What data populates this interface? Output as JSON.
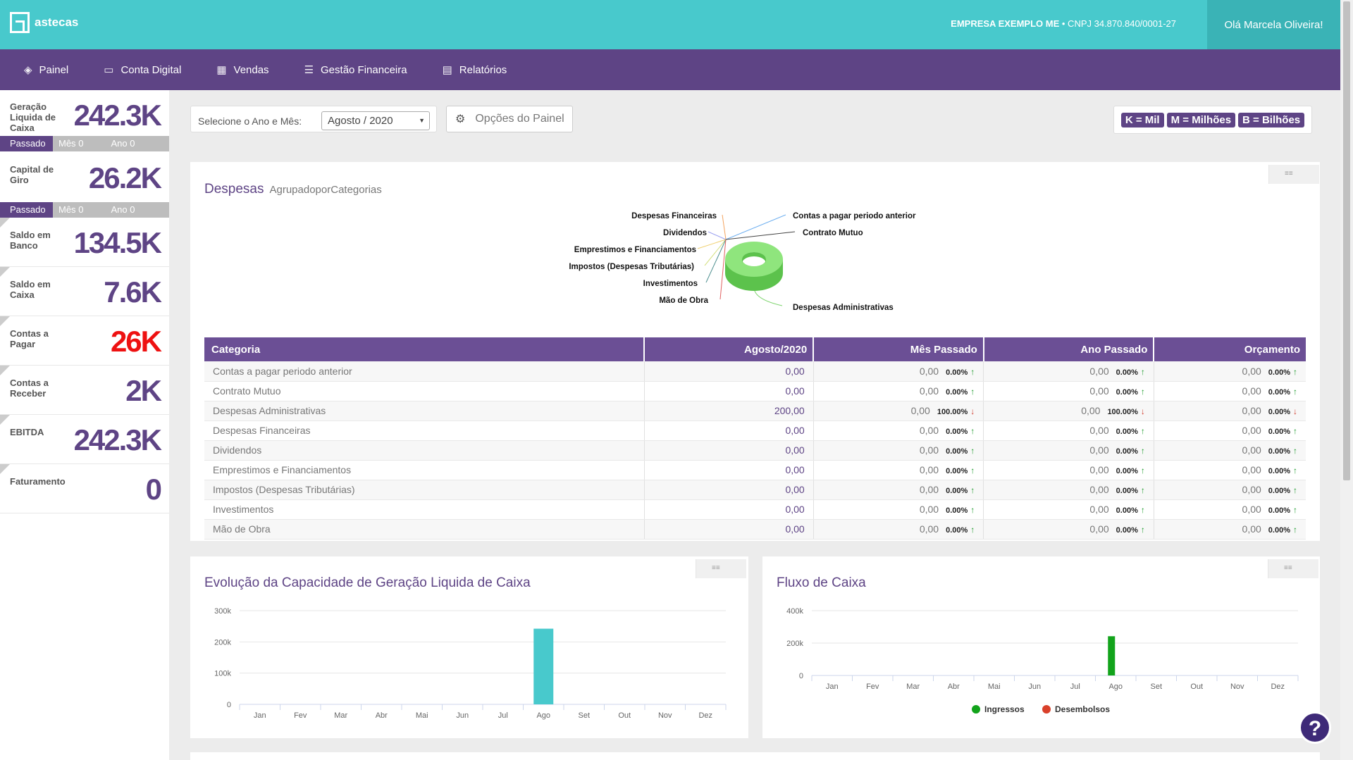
{
  "brand": {
    "name": "astecas",
    "accent": "#48c9cc",
    "purple": "#5e4485"
  },
  "header": {
    "company_name": "EMPRESA EXEMPLO ME",
    "company_cnpj": "• CNPJ 34.870.840/0001-27",
    "greeting": "Olá Marcela Oliveira!"
  },
  "nav": [
    {
      "label": "Painel",
      "icon": "cube-icon"
    },
    {
      "label": "Conta Digital",
      "icon": "credit-card-icon"
    },
    {
      "label": "Vendas",
      "icon": "calculator-icon"
    },
    {
      "label": "Gestão Financeira",
      "icon": "list-icon"
    },
    {
      "label": "Relatórios",
      "icon": "report-icon"
    }
  ],
  "sidebar": {
    "kpis": [
      {
        "label": "Geração Liquida de Caixa",
        "value": "242.3K"
      },
      {
        "label": "Capital de Giro",
        "value": "26.2K"
      },
      {
        "label": "Saldo em Banco",
        "value": "134.5K"
      },
      {
        "label": "Saldo em Caixa",
        "value": "7.6K"
      },
      {
        "label": "Contas a Pagar",
        "value": "26K"
      },
      {
        "label": "Contas a Receber",
        "value": "2K"
      },
      {
        "label": "EBITDA",
        "value": "242.3K"
      },
      {
        "label": "Faturamento",
        "value": "0"
      }
    ],
    "compare": {
      "passado": "Passado",
      "mes": "Mês",
      "ano": "Ano",
      "mes_val": "0",
      "ano_val": "0"
    }
  },
  "filters": {
    "label": "Selecione o Ano e Mês:",
    "selected": "Agosto / 2020",
    "options_button": "Opções do Painel"
  },
  "units": [
    "K = Mil",
    "M = Milhões",
    "B = Bilhões"
  ],
  "despesas": {
    "title": "Despesas",
    "subtitle": "AgrupadoporCategorias",
    "pie_labels_left": [
      "Despesas Financeiras",
      "Dividendos",
      "Emprestimos e Financiamentos",
      "Impostos (Despesas Tributárias)",
      "Investimentos",
      "Mão de Obra"
    ],
    "pie_labels_right": [
      "Contas a pagar periodo anterior",
      "Contrato Mutuo",
      "Despesas Administrativas"
    ],
    "columns": [
      "Categoria",
      "Agosto/2020",
      "Mês Passado",
      "Ano Passado",
      "Orçamento"
    ],
    "rows": [
      {
        "cat": "Contas a pagar periodo anterior",
        "cur": "0,00",
        "mp": "0,00",
        "mpp": "0.00%",
        "mpd": "up",
        "ap": "0,00",
        "app": "0.00%",
        "apd": "up",
        "orc": "0,00",
        "orcp": "0.00%",
        "orcd": "up"
      },
      {
        "cat": "Contrato Mutuo",
        "cur": "0,00",
        "mp": "0,00",
        "mpp": "0.00%",
        "mpd": "up",
        "ap": "0,00",
        "app": "0.00%",
        "apd": "up",
        "orc": "0,00",
        "orcp": "0.00%",
        "orcd": "up"
      },
      {
        "cat": "Despesas Administrativas",
        "cur": "200,00",
        "mp": "0,00",
        "mpp": "100.00%",
        "mpd": "down",
        "ap": "0,00",
        "app": "100.00%",
        "apd": "down",
        "orc": "0,00",
        "orcp": "0.00%",
        "orcd": "down"
      },
      {
        "cat": "Despesas Financeiras",
        "cur": "0,00",
        "mp": "0,00",
        "mpp": "0.00%",
        "mpd": "up",
        "ap": "0,00",
        "app": "0.00%",
        "apd": "up",
        "orc": "0,00",
        "orcp": "0.00%",
        "orcd": "up"
      },
      {
        "cat": "Dividendos",
        "cur": "0,00",
        "mp": "0,00",
        "mpp": "0.00%",
        "mpd": "up",
        "ap": "0,00",
        "app": "0.00%",
        "apd": "up",
        "orc": "0,00",
        "orcp": "0.00%",
        "orcd": "up"
      },
      {
        "cat": "Emprestimos e Financiamentos",
        "cur": "0,00",
        "mp": "0,00",
        "mpp": "0.00%",
        "mpd": "up",
        "ap": "0,00",
        "app": "0.00%",
        "apd": "up",
        "orc": "0,00",
        "orcp": "0.00%",
        "orcd": "up"
      },
      {
        "cat": "Impostos (Despesas Tributárias)",
        "cur": "0,00",
        "mp": "0,00",
        "mpp": "0.00%",
        "mpd": "up",
        "ap": "0,00",
        "app": "0.00%",
        "apd": "up",
        "orc": "0,00",
        "orcp": "0.00%",
        "orcd": "up"
      },
      {
        "cat": "Investimentos",
        "cur": "0,00",
        "mp": "0,00",
        "mpp": "0.00%",
        "mpd": "up",
        "ap": "0,00",
        "app": "0.00%",
        "apd": "up",
        "orc": "0,00",
        "orcp": "0.00%",
        "orcd": "up"
      },
      {
        "cat": "Mão de Obra",
        "cur": "0,00",
        "mp": "0,00",
        "mpp": "0.00%",
        "mpd": "up",
        "ap": "0,00",
        "app": "0.00%",
        "apd": "up",
        "orc": "0,00",
        "orcp": "0.00%",
        "orcd": "up"
      }
    ]
  },
  "chart_data": [
    {
      "type": "bar",
      "title": "Evolução da Capacidade de Geração Liquida de Caixa",
      "categories": [
        "Jan",
        "Fev",
        "Mar",
        "Abr",
        "Mai",
        "Jun",
        "Jul",
        "Ago",
        "Set",
        "Out",
        "Nov",
        "Dez"
      ],
      "series": [
        {
          "values": [
            0,
            0,
            0,
            0,
            0,
            0,
            0,
            242300,
            0,
            0,
            0,
            0
          ],
          "color": "#48c9cc"
        }
      ],
      "ylim": [
        0,
        300000
      ],
      "yticks": [
        "0",
        "100k",
        "200k",
        "300k"
      ],
      "grid": true
    },
    {
      "type": "bar",
      "title": "Fluxo de Caixa",
      "categories": [
        "Jan",
        "Fev",
        "Mar",
        "Abr",
        "Mai",
        "Jun",
        "Jul",
        "Ago",
        "Set",
        "Out",
        "Nov",
        "Dez"
      ],
      "series": [
        {
          "name": "Ingressos",
          "values": [
            0,
            0,
            0,
            0,
            0,
            0,
            0,
            242300,
            0,
            0,
            0,
            0
          ],
          "color": "#12a31b"
        },
        {
          "name": "Desembolsos",
          "values": [
            0,
            0,
            0,
            0,
            0,
            0,
            0,
            0,
            0,
            0,
            0,
            0
          ],
          "color": "#d9402a"
        }
      ],
      "ylim": [
        0,
        400000
      ],
      "yticks": [
        "0",
        "200k",
        "400k"
      ],
      "legend": "bottom",
      "grid": true
    }
  ]
}
